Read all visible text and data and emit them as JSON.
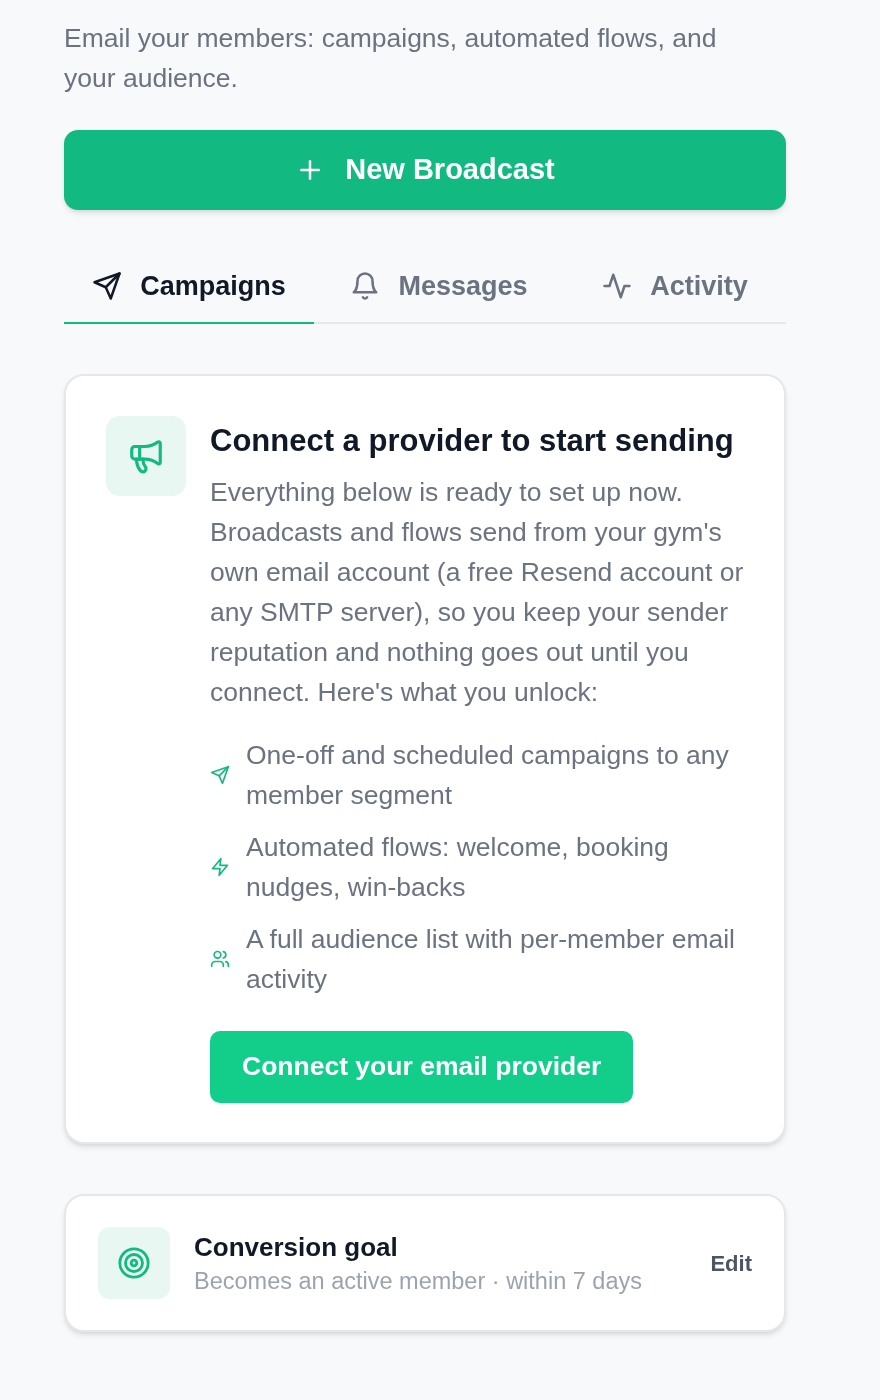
{
  "intro": "Email your members: campaigns, automated flows, and your audience.",
  "new_broadcast_button": {
    "label": "New Broadcast"
  },
  "tabs": [
    {
      "label": "Campaigns",
      "selected": true
    },
    {
      "label": "Messages",
      "selected": false
    },
    {
      "label": "Activity",
      "selected": false
    }
  ],
  "provider_card": {
    "title": "Connect a provider to start sending",
    "body": "Everything below is ready to set up now. Broadcasts and flows send from your gym's own email account (a free Resend account or any SMTP server), so you keep your sender reputation and nothing goes out until you connect. Here's what you unlock:",
    "features": [
      "One-off and scheduled campaigns to any member segment",
      "Automated flows: welcome, booking nudges, win-backs",
      "A full audience list with per-member email activity"
    ],
    "button": "Connect your email provider"
  },
  "goal_card": {
    "title": "Conversion goal",
    "subtitle": "Becomes an active member · within 7 days",
    "action": "Edit"
  }
}
